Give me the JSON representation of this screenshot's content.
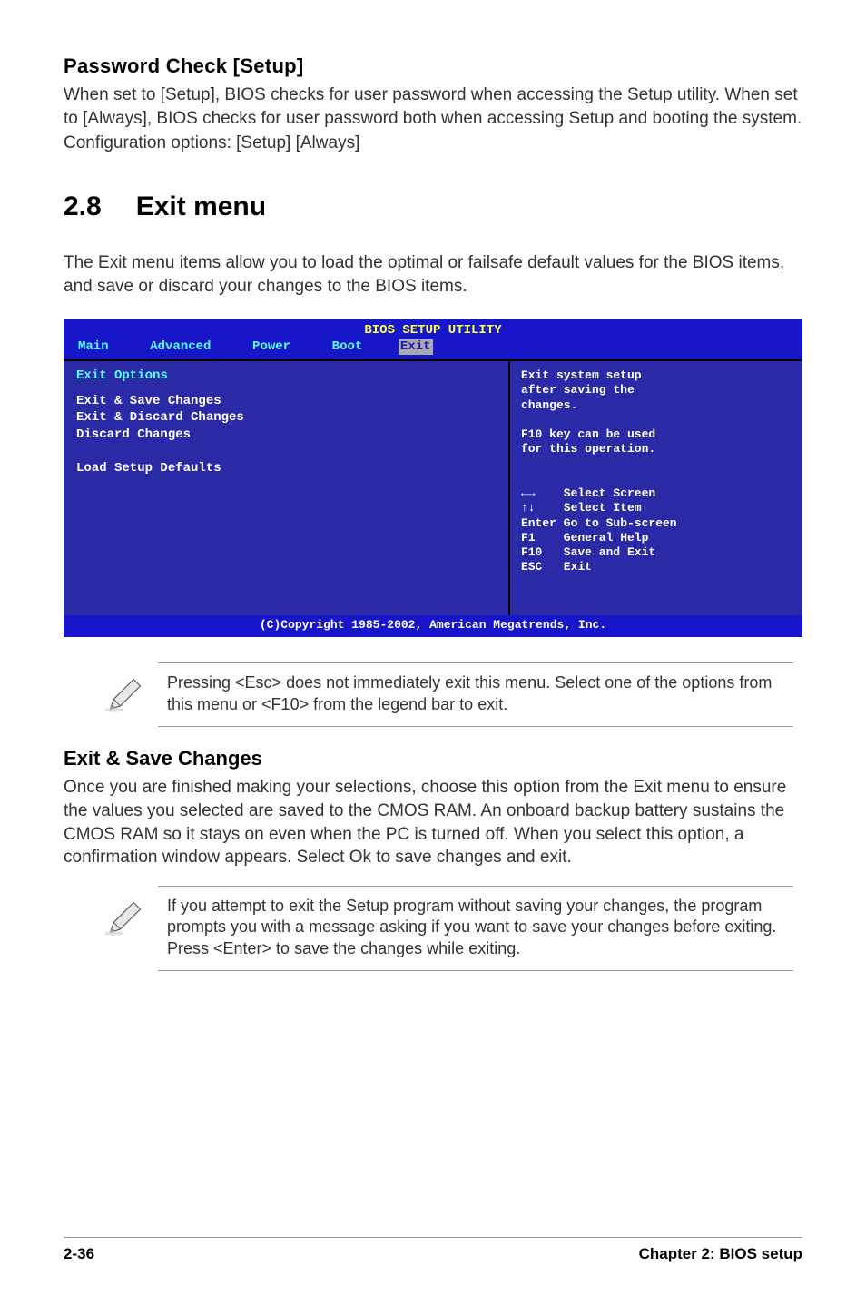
{
  "password_check": {
    "heading": "Password Check [Setup]",
    "para1": "When set to [Setup], BIOS checks for user password when accessing the Setup utility. When set to [Always], BIOS checks for user password both when accessing Setup and booting the system.",
    "para2": "Configuration options: [Setup] [Always]"
  },
  "section": {
    "number": "2.8",
    "title": "Exit menu",
    "intro": "The Exit menu items allow you to load the optimal or failsafe default values for the BIOS items, and save or discard your changes to the BIOS items."
  },
  "bios": {
    "title": "BIOS SETUP UTILITY",
    "tabs": [
      "Main",
      "Advanced",
      "Power",
      "Boot",
      "Exit"
    ],
    "active_tab": "Exit",
    "left_title": "Exit Options",
    "left_items": [
      "Exit & Save Changes",
      "Exit & Discard Changes",
      "Discard Changes",
      "",
      "Load Setup Defaults"
    ],
    "help_lines": [
      "Exit system setup",
      "after saving the",
      "changes.",
      "",
      "F10 key can be used",
      "for this operation."
    ],
    "nav": [
      {
        "key": "←→",
        "label": "Select Screen"
      },
      {
        "key": "↑↓",
        "label": "Select Item"
      },
      {
        "key": "Enter",
        "label": "Go to Sub-screen"
      },
      {
        "key": "F1",
        "label": "General Help"
      },
      {
        "key": "F10",
        "label": "Save and Exit"
      },
      {
        "key": "ESC",
        "label": "Exit"
      }
    ],
    "copyright": "(C)Copyright 1985-2002, American Megatrends, Inc."
  },
  "note1": "Pressing <Esc> does not immediately exit this menu. Select one of the options from this menu or <F10> from the legend bar to exit.",
  "exit_save": {
    "heading": "Exit & Save Changes",
    "para": "Once you are finished making your selections, choose this option from the Exit menu to ensure the values you selected are saved to the CMOS RAM. An onboard backup battery sustains the CMOS RAM so it stays on even when the PC is turned off. When you select this option, a confirmation window appears. Select Ok to save changes and exit."
  },
  "note2": " If you attempt to exit the Setup program without saving your changes, the program prompts you with a message asking if you want to save your changes before exiting. Press <Enter>  to save the  changes while exiting.",
  "footer": {
    "left": "2-36",
    "right": "Chapter 2: BIOS setup"
  }
}
